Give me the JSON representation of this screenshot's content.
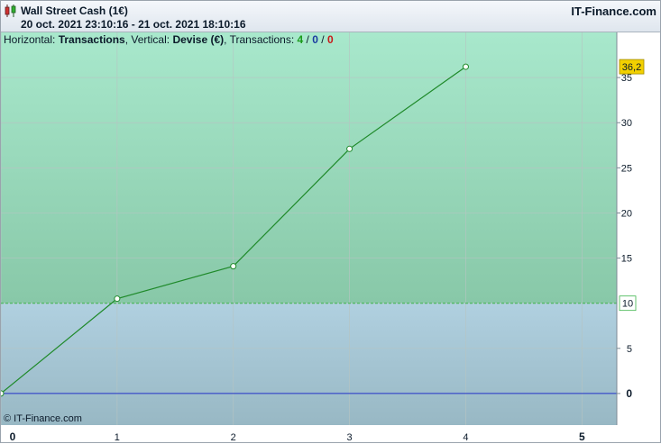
{
  "header": {
    "title": "Wall Street Cash (1€)",
    "date_range": "20 oct. 2021 23:10:16 - 21 oct. 2021 18:10:16",
    "brand": "IT-Finance.com",
    "logo_icon": "candlestick-icon"
  },
  "info": {
    "horizontal_label": "Horizontal:",
    "horizontal_value": "Transactions",
    "vertical_label": ", Vertical:",
    "vertical_value": "Devise (€)",
    "transactions_label": ", Transactions:",
    "tx_total": "4",
    "sep1": " / ",
    "tx_mid": "0",
    "sep2": " / ",
    "tx_last": "0"
  },
  "copyright": "© IT-Finance.com",
  "colors": {
    "upper_zone_top": "#a8e8cc",
    "upper_zone_bottom": "#88c8a8",
    "lower_zone_top": "#b0d0e0",
    "lower_zone_bottom": "#98b8c4",
    "line": "#1f8a2a",
    "zero_line": "#2030c8",
    "threshold_line": "#3cb44a",
    "last_value_badge": "#f2d000"
  },
  "chart_data": {
    "type": "line",
    "x": [
      0,
      1,
      2,
      3,
      4
    ],
    "values": [
      0,
      10.5,
      14.1,
      27.1,
      36.2
    ],
    "xlim": [
      0,
      5.3
    ],
    "ylim": [
      -3.5,
      40
    ],
    "x_ticks": [
      "0",
      "1",
      "2",
      "3",
      "4",
      "5"
    ],
    "y_ticks": [
      "0",
      "5",
      "10",
      "15",
      "20",
      "25",
      "30",
      "35"
    ],
    "threshold": 10,
    "threshold_label": "10",
    "last_value_label": "36,2",
    "grid": true,
    "xlabel": "",
    "ylabel": ""
  }
}
